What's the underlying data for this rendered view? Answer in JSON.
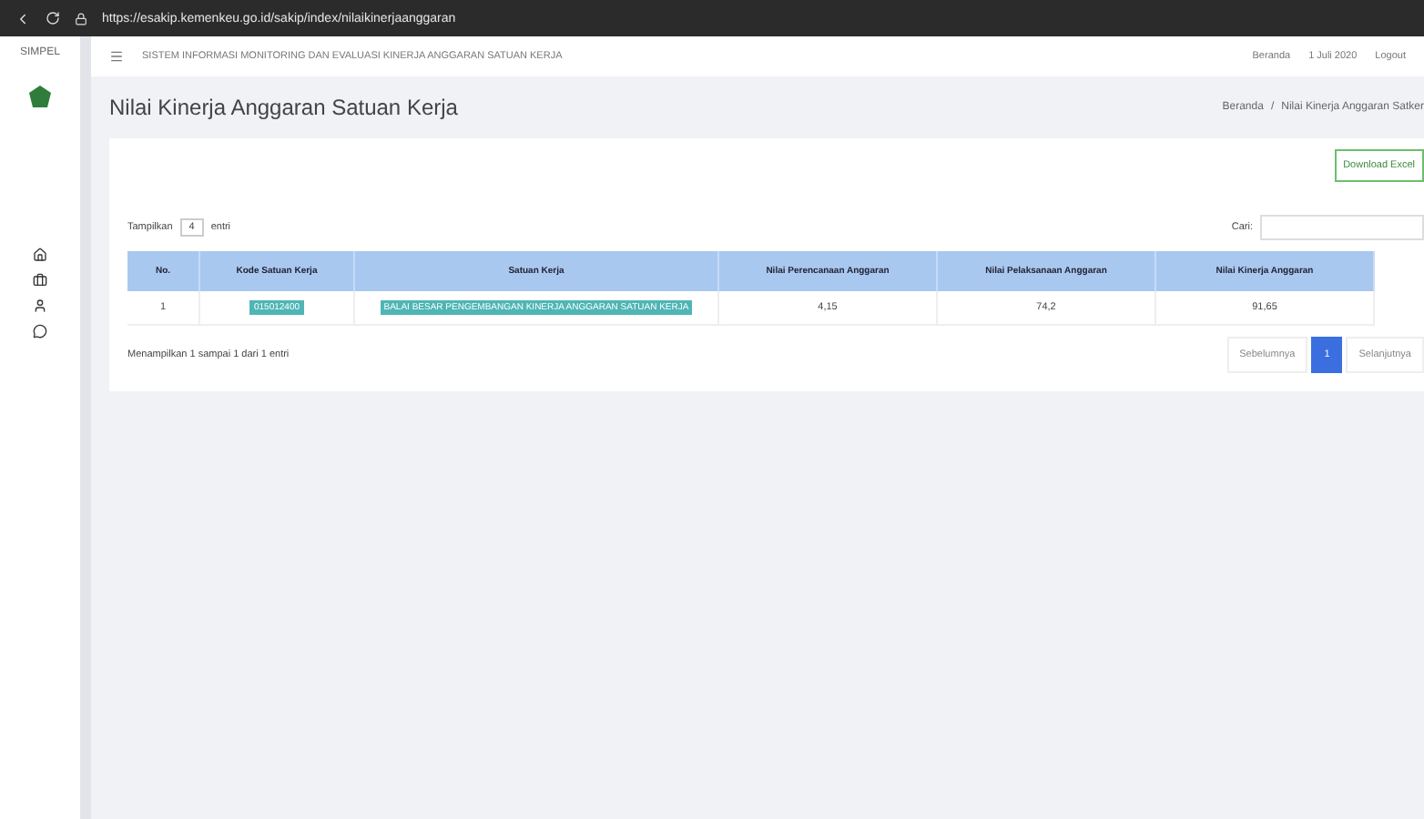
{
  "browser": {
    "url": "https://esakip.kemenkeu.go.id/sakip/index/nilaikinerjaanggaran"
  },
  "topbar": {
    "brand": "SIMPEL",
    "heading": "SISTEM INFORMASI MONITORING DAN EVALUASI KINERJA ANGGARAN SATUAN KERJA",
    "links": [
      "Beranda",
      "1 Juli 2020",
      "Logout"
    ]
  },
  "page": {
    "title": "Nilai Kinerja Anggaran Satuan Kerja",
    "breadcrumb": [
      "Beranda",
      "Nilai Kinerja Anggaran Satker"
    ],
    "breadcrumb_separator": "/",
    "export_button": "Download Excel"
  },
  "table": {
    "length_label": "Tampilkan",
    "length_value": "4",
    "length_suffix": "entri",
    "search_label": "Cari:",
    "columns": [
      "No.",
      "Kode Satuan Kerja",
      "Satuan Kerja",
      "Nilai Perencanaan Anggaran",
      "Nilai Pelaksanaan Anggaran",
      "Nilai Kinerja Anggaran"
    ],
    "rows": [
      [
        "1",
        "015012400",
        "BALAI BESAR PENGEMBANGAN KINERJA ANGGARAN SATUAN KERJA",
        "4,15",
        "74,2",
        "91,65"
      ]
    ],
    "info": "Menampilkan 1 sampai 1 dari 1 entri",
    "pagination": [
      {
        "label": "Sebelumnya",
        "selected": false
      },
      {
        "label": "1",
        "selected": true
      },
      {
        "label": "Selanjutnya",
        "selected": false
      }
    ]
  }
}
